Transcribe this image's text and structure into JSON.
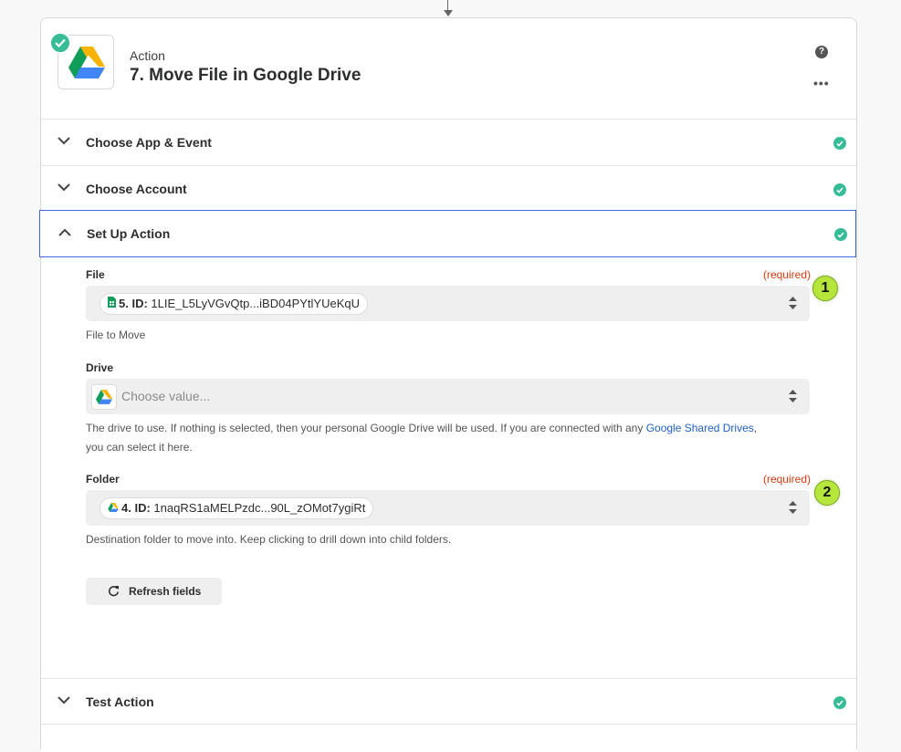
{
  "header": {
    "kind": "Action",
    "title": "7. Move File in Google Drive",
    "help_symbol": "?",
    "more_symbol": "•••"
  },
  "sections": {
    "choose_app": "Choose App & Event",
    "choose_account": "Choose Account",
    "setup_action": "Set Up Action",
    "test_action": "Test Action"
  },
  "fields": {
    "file": {
      "label": "File",
      "required": "(required)",
      "value_step": "5. ID:",
      "value_text": "1LIE_L5LyVGvQtp...iBD04PYtlYUeKqU",
      "help": "File to Move"
    },
    "drive": {
      "label": "Drive",
      "placeholder": "Choose value...",
      "help_prefix": "The drive to use. If nothing is selected, then your personal Google Drive will be used. If you are connected with any ",
      "help_link": "Google Shared Drives",
      "help_suffix": ",",
      "help_line2": "you can select it here."
    },
    "folder": {
      "label": "Folder",
      "required": "(required)",
      "value_step": "4. ID:",
      "value_text": "1naqRS1aMELPzdc...90L_zOMot7ygiRt",
      "help": "Destination folder to move into. Keep clicking to drill down into child folders."
    }
  },
  "annotations": {
    "badge_1": "1",
    "badge_2": "2"
  },
  "refresh_button": "Refresh fields",
  "colors": {
    "success": "#37bc98",
    "required": "#d93b10",
    "link": "#1f61c4",
    "active_border": "#3f6ad8",
    "badge": "#b6e63c"
  }
}
